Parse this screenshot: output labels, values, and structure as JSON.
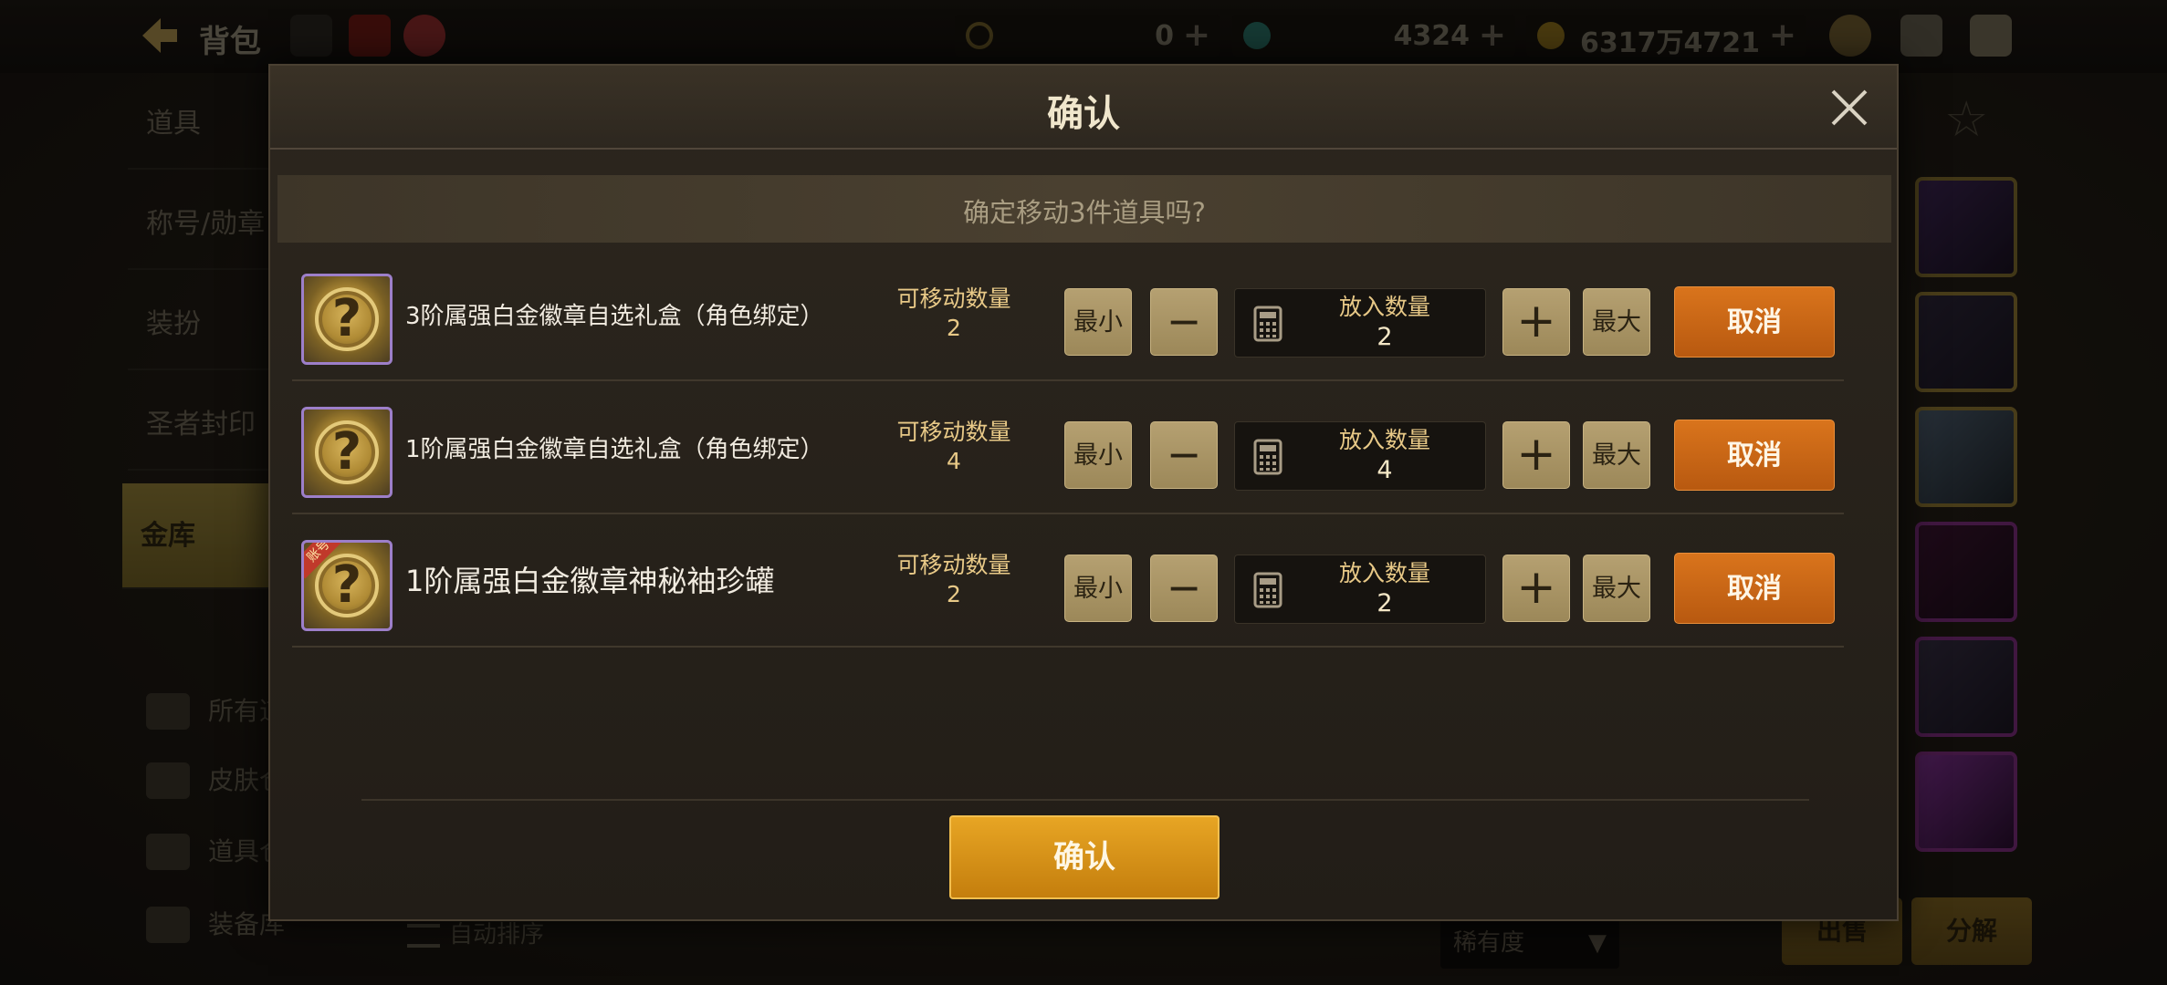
{
  "topbar": {
    "title": "背包",
    "currencies": [
      {
        "value": "0"
      },
      {
        "value": "4324"
      },
      {
        "value": "6317万4721"
      }
    ]
  },
  "left_nav": {
    "tabs": [
      "道具",
      "称号/勋章",
      "装扮",
      "圣者封印",
      "金库"
    ],
    "sub_items": [
      "所有道",
      "皮肤仓",
      "道具仓",
      "装备库"
    ],
    "extra": "自动排序"
  },
  "bottom": {
    "select_value": "稀有度",
    "sell_label": "出售",
    "dismantle_label": "分解"
  },
  "modal": {
    "title": "确认",
    "prompt": "确定移动3件道具吗?",
    "confirm_label": "确认",
    "items": [
      {
        "name": "3阶属强白金徽章自选礼盒（角色绑定）",
        "movable_label": "可移动数量",
        "movable_value": "2",
        "min_label": "最小",
        "max_label": "最大",
        "qty_label": "放入数量",
        "qty_value": "2",
        "cancel_label": "取消"
      },
      {
        "name": "1阶属强白金徽章自选礼盒（角色绑定）",
        "movable_label": "可移动数量",
        "movable_value": "4",
        "min_label": "最小",
        "max_label": "最大",
        "qty_label": "放入数量",
        "qty_value": "4",
        "cancel_label": "取消"
      },
      {
        "name": "1阶属强白金徽章神秘袖珍罐",
        "tag": "账号",
        "movable_label": "可移动数量",
        "movable_value": "2",
        "min_label": "最小",
        "max_label": "最大",
        "qty_label": "放入数量",
        "qty_value": "2",
        "cancel_label": "取消"
      }
    ]
  },
  "colors": {
    "accent_orange": "#c8650f",
    "confirm_gold": "#d8940f",
    "tan_button": "#a8946a"
  }
}
